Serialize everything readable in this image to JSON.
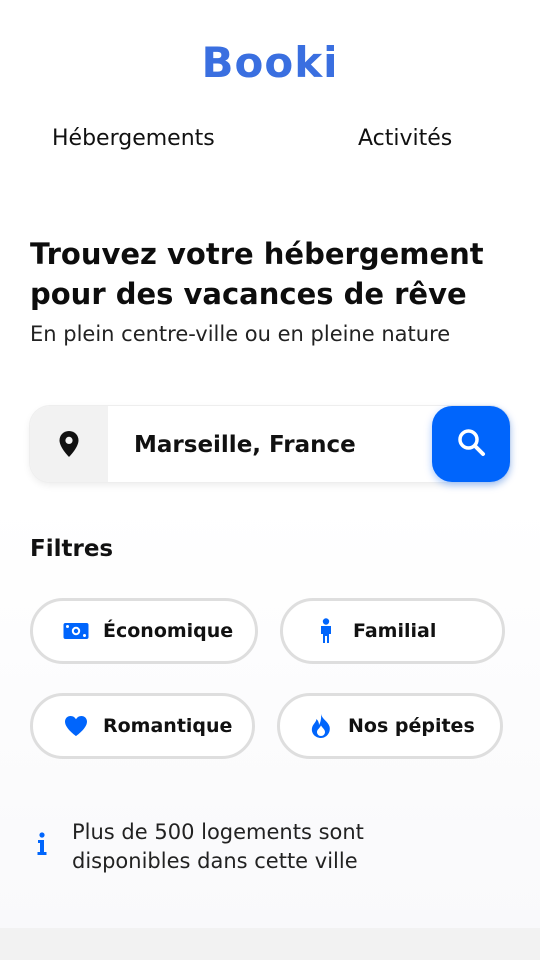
{
  "header": {
    "logo_text": "Booki",
    "nav": [
      {
        "label": "Hébergements"
      },
      {
        "label": "Activités"
      }
    ]
  },
  "hero": {
    "title": "Trouvez votre hébergement pour des vacances de rêve",
    "subtitle": "En plein centre-ville ou en pleine nature"
  },
  "search": {
    "location_icon": "map-pin-icon",
    "value": "Marseille, France",
    "button_icon": "search-icon",
    "button_color": "#0065fc"
  },
  "filters": {
    "title": "Filtres",
    "items": [
      {
        "label": "Économique",
        "icon": "money-icon"
      },
      {
        "label": "Familial",
        "icon": "person-icon"
      },
      {
        "label": "Romantique",
        "icon": "heart-icon"
      },
      {
        "label": "Nos pépites",
        "icon": "fire-icon"
      }
    ]
  },
  "info": {
    "icon": "info-icon",
    "text": "Plus de 500 logements sont disponibles dans cette ville"
  },
  "colors": {
    "accent": "#0065fc",
    "logo": "#3a6fe0",
    "chip_border": "#dedede"
  }
}
